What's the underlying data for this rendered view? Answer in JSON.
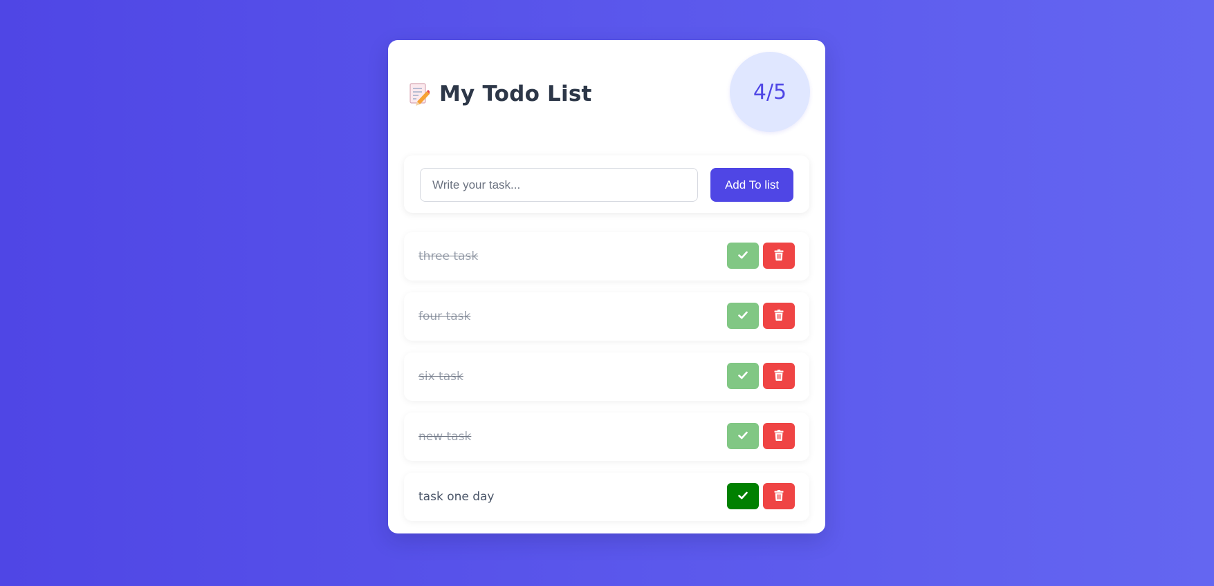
{
  "header": {
    "icon": "memo-icon",
    "title": "My Todo List",
    "counter": "4/5"
  },
  "form": {
    "placeholder": "Write your task...",
    "value": "",
    "add_label": "Add To list"
  },
  "todos": [
    {
      "text": "three task",
      "completed": true
    },
    {
      "text": "four task",
      "completed": true
    },
    {
      "text": "six task",
      "completed": true
    },
    {
      "text": "new task",
      "completed": true
    },
    {
      "text": "task one day",
      "completed": false
    }
  ],
  "icons": {
    "complete": "checkmark-icon",
    "delete": "trash-icon"
  },
  "colors": {
    "background_start": "#4f46e5",
    "background_end": "#6466f1",
    "accent": "#4f46e5",
    "counter_bg": "#e0e7ff",
    "complete_active": "#008000",
    "complete_done": "#81c784",
    "delete": "#ef4444"
  }
}
